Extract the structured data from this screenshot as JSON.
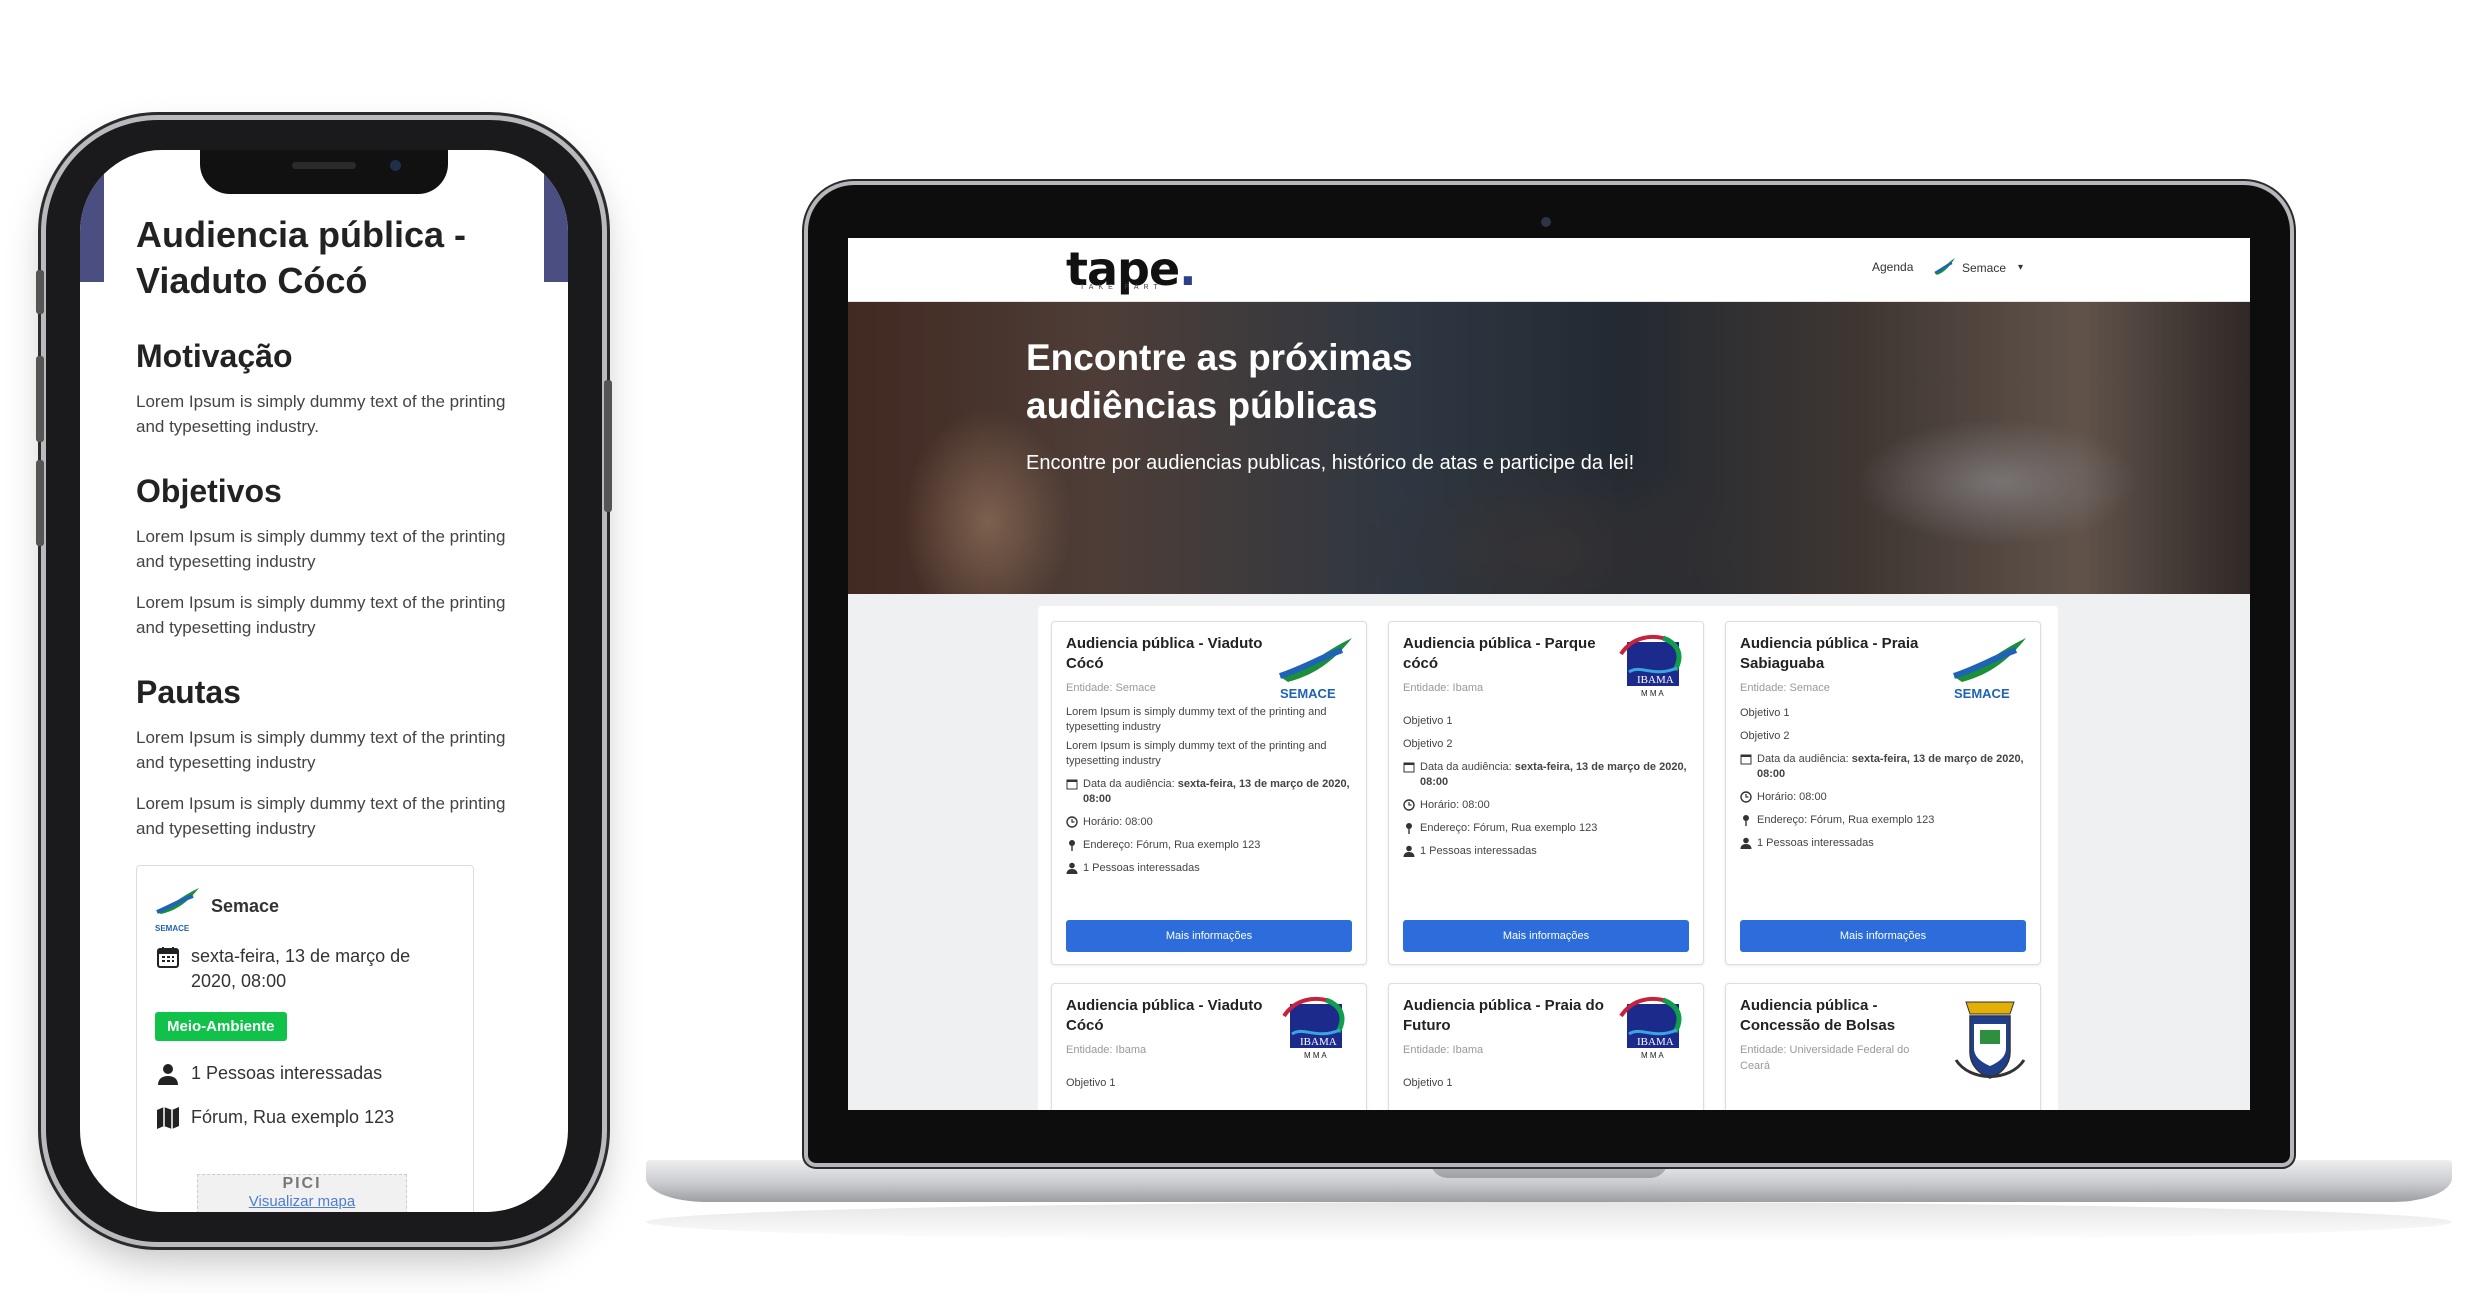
{
  "mobile": {
    "title": "Audiencia pública - Viaduto Cócó",
    "sections": [
      {
        "heading": "Motivação",
        "paragraphs": [
          "Lorem Ipsum is simply dummy text of the printing and typesetting industry."
        ]
      },
      {
        "heading": "Objetivos",
        "paragraphs": [
          "Lorem Ipsum is simply dummy text of the printing and typesetting industry",
          "Lorem Ipsum is simply dummy text of the printing and typesetting industry"
        ]
      },
      {
        "heading": "Pautas",
        "paragraphs": [
          "Lorem Ipsum is simply dummy text of the printing and typesetting industry",
          "Lorem Ipsum is simply dummy text of the printing and typesetting industry"
        ]
      }
    ],
    "card": {
      "entity": "Semace",
      "logo_text": "SEMACE",
      "date": "sexta-feira, 13 de março de 2020, 08:00",
      "tag": "Meio-Ambiente",
      "interested": "1 Pessoas interessadas",
      "address": "Fórum, Rua exemplo 123",
      "map_label": "PICI",
      "map_link": "Visualizar mapa"
    }
  },
  "desktop": {
    "nav": {
      "logo": "tape",
      "logo_dot": ".",
      "logo_sub": "TAKE PART",
      "agenda": "Agenda",
      "user": "Semace",
      "user_caret": "▾"
    },
    "hero": {
      "title": "Encontre as próximas audiências públicas",
      "subtitle": "Encontre por audiencias publicas, histórico de atas e participe da lei!"
    },
    "button_label": "Mais informações",
    "cards": [
      {
        "title": "Audiencia pública - Viaduto Cócó",
        "entity": "Entidade: Semace",
        "logo": "semace",
        "lines": [
          "Lorem Ipsum is simply dummy text of the printing and typesetting industry",
          "Lorem Ipsum is simply dummy text of the printing and typesetting industry"
        ],
        "date_label": "Data da audiência:",
        "date_value": "sexta-feira, 13 de março de 2020, 08:00",
        "time": "Horário: 08:00",
        "address": "Endereço: Fórum, Rua exemplo 123",
        "interested": "1 Pessoas interessadas"
      },
      {
        "title": "Audiencia pública - Parque cócó",
        "entity": "Entidade: Ibama",
        "logo": "ibama",
        "lines": [
          "Objetivo 1",
          "Objetivo 2"
        ],
        "date_label": "Data da audiência:",
        "date_value": "sexta-feira, 13 de março de 2020, 08:00",
        "time": "Horário: 08:00",
        "address": "Endereço: Fórum, Rua exemplo 123",
        "interested": "1 Pessoas interessadas"
      },
      {
        "title": "Audiencia pública - Praia Sabiaguaba",
        "entity": "Entidade: Semace",
        "logo": "semace",
        "lines": [
          "Objetivo 1",
          "Objetivo 2"
        ],
        "date_label": "Data da audiência:",
        "date_value": "sexta-feira, 13 de março de 2020, 08:00",
        "time": "Horário: 08:00",
        "address": "Endereço: Fórum, Rua exemplo 123",
        "interested": "1 Pessoas interessadas"
      },
      {
        "title": "Audiencia pública - Viaduto Cócó",
        "entity": "Entidade: Ibama",
        "logo": "ibama",
        "lines": [
          "Objetivo 1"
        ]
      },
      {
        "title": "Audiencia pública - Praia do Futuro",
        "entity": "Entidade: Ibama",
        "logo": "ibama",
        "lines": [
          "Objetivo 1"
        ]
      },
      {
        "title": "Audiencia pública - Concessão de Bolsas",
        "entity": "Entidade: Universidade Federal do Ceará",
        "logo": "ufc",
        "lines": []
      }
    ],
    "logo_texts": {
      "semace": "SEMACE",
      "ibama": "IBAMA",
      "ibama_sub": "M M A"
    }
  },
  "colors": {
    "primary_button": "#2d6ddb",
    "tag_green": "#10c24a",
    "logo_dot": "#2c3f8c",
    "phone_band": "#4a4e80"
  }
}
